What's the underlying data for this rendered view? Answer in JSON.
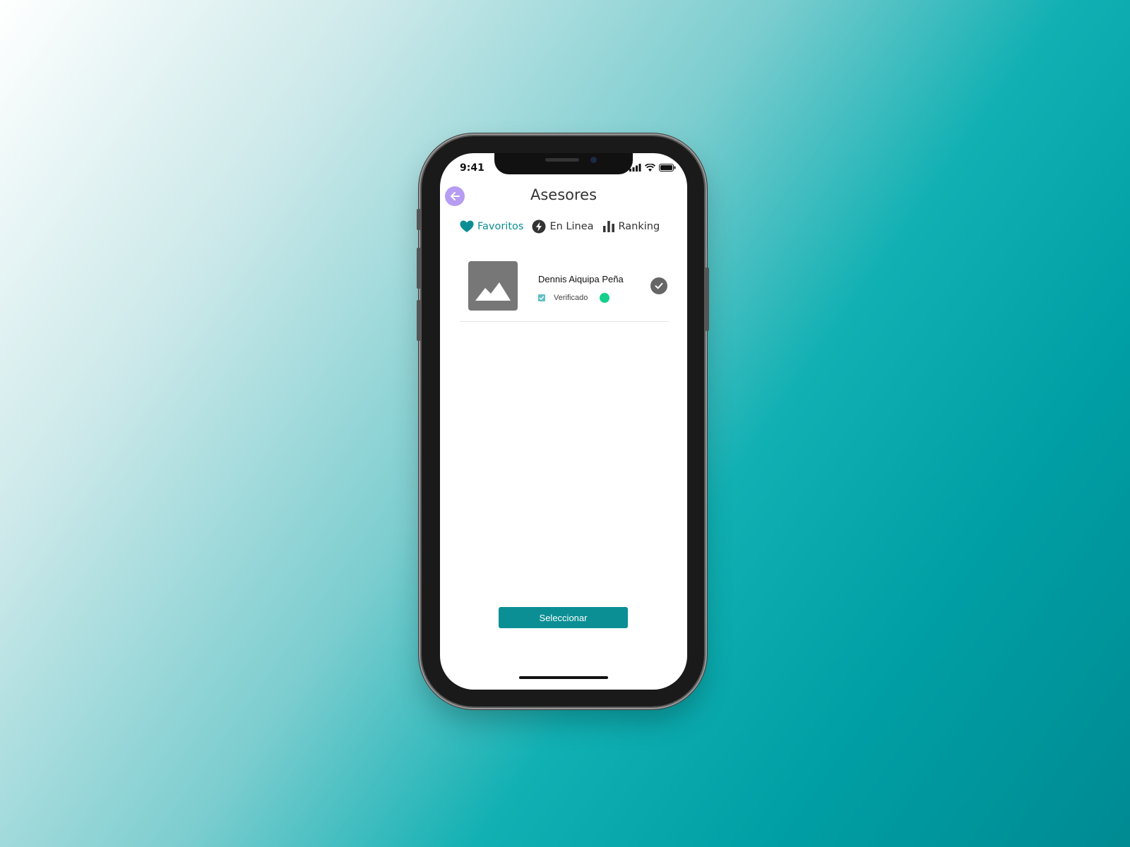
{
  "status_bar": {
    "time": "9:41"
  },
  "header": {
    "title": "Asesores"
  },
  "tabs": [
    {
      "label": "Favoritos",
      "icon": "heart-icon",
      "active": true
    },
    {
      "label": "En Linea",
      "icon": "bolt-icon",
      "active": false
    },
    {
      "label": "Ranking",
      "icon": "bar-chart-icon",
      "active": false
    }
  ],
  "advisors": [
    {
      "name": "Dennis Aiquipa Peña",
      "verified_label": "Verificado",
      "online": true,
      "selected": true
    }
  ],
  "footer": {
    "select_label": "Seleccionar"
  },
  "colors": {
    "accent": "#0b8f94",
    "back_button": "#b69cf2",
    "online": "#15cf8a",
    "verified": "#5fc0c4"
  }
}
